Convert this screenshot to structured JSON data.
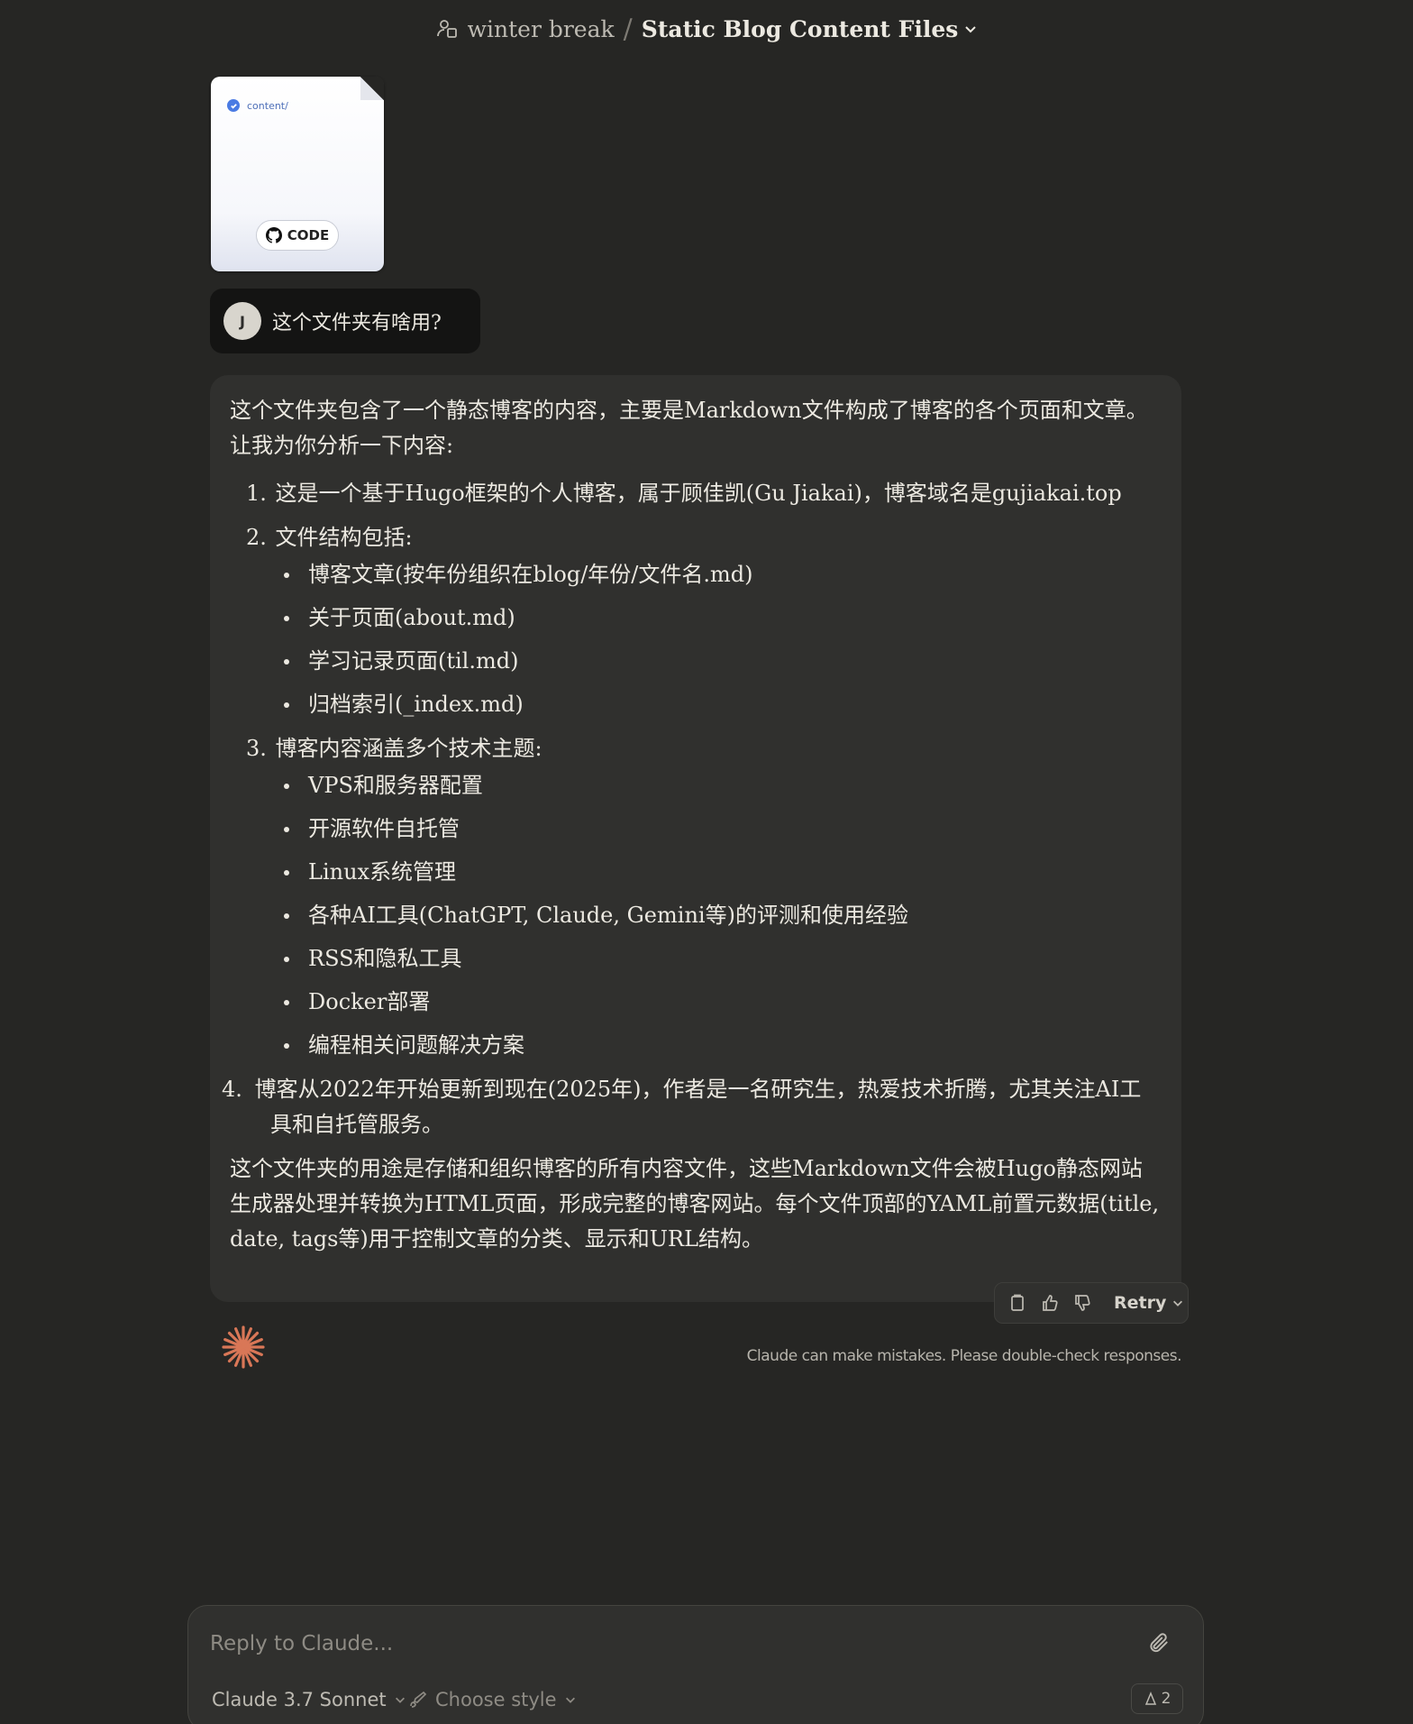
{
  "header": {
    "project_name": "winter break",
    "separator": "/",
    "chat_title": "Static Blog Content Files"
  },
  "attachment": {
    "path": "content/",
    "badge_label": "CODE"
  },
  "user_message": {
    "avatar_initial": "J",
    "text": "这个文件夹有啥用?"
  },
  "assistant_message": {
    "intro": "这个文件夹包含了一个静态博客的内容，主要是Markdown文件构成了博客的各个页面和文章。让我为你分析一下内容:",
    "items": [
      {
        "num": "1.",
        "text": "这是一个基于Hugo框架的个人博客，属于顾佳凯(Gu Jiakai)，博客域名是gujiakai.top"
      },
      {
        "num": "2.",
        "text": "文件结构包括:"
      },
      {
        "num": "3.",
        "text": "博客内容涵盖多个技术主题:"
      },
      {
        "num": "4.",
        "text": "博客从2022年开始更新到现在(2025年)，作者是一名研究生，热爱技术折腾，尤其关注AI工具和自托管服务。"
      }
    ],
    "structure_bullets": [
      "博客文章(按年份组织在blog/年份/文件名.md)",
      "关于页面(about.md)",
      "学习记录页面(til.md)",
      "归档索引(_index.md)"
    ],
    "topic_bullets": [
      "VPS和服务器配置",
      "开源软件自托管",
      "Linux系统管理",
      "各种AI工具(ChatGPT, Claude, Gemini等)的评测和使用经验",
      "RSS和隐私工具",
      "Docker部署",
      "编程相关问题解决方案"
    ],
    "outro": "这个文件夹的用途是存储和组织博客的所有内容文件，这些Markdown文件会被Hugo静态网站生成器处理并转换为HTML页面，形成完整的博客网站。每个文件顶部的YAML前置元数据(title, date, tags等)用于控制文章的分类、显示和URL结构。"
  },
  "actions": {
    "retry_label": "Retry"
  },
  "disclaimer": "Claude can make mistakes. Please double-check responses.",
  "composer": {
    "placeholder": "Reply to Claude...",
    "model_label": "Claude 3.7 Sonnet",
    "style_label": "Choose style",
    "count": "2"
  },
  "colors": {
    "background": "#262624",
    "bubble": "#30302e",
    "user_bubble": "#141413",
    "accent_spark": "#d97757"
  },
  "icons": [
    "project-icon",
    "chevron-down-icon",
    "check-icon",
    "github-icon",
    "copy-icon",
    "thumbs-up-icon",
    "thumbs-down-icon",
    "claude-spark-icon",
    "paperclip-icon",
    "brush-icon",
    "user-icon"
  ]
}
